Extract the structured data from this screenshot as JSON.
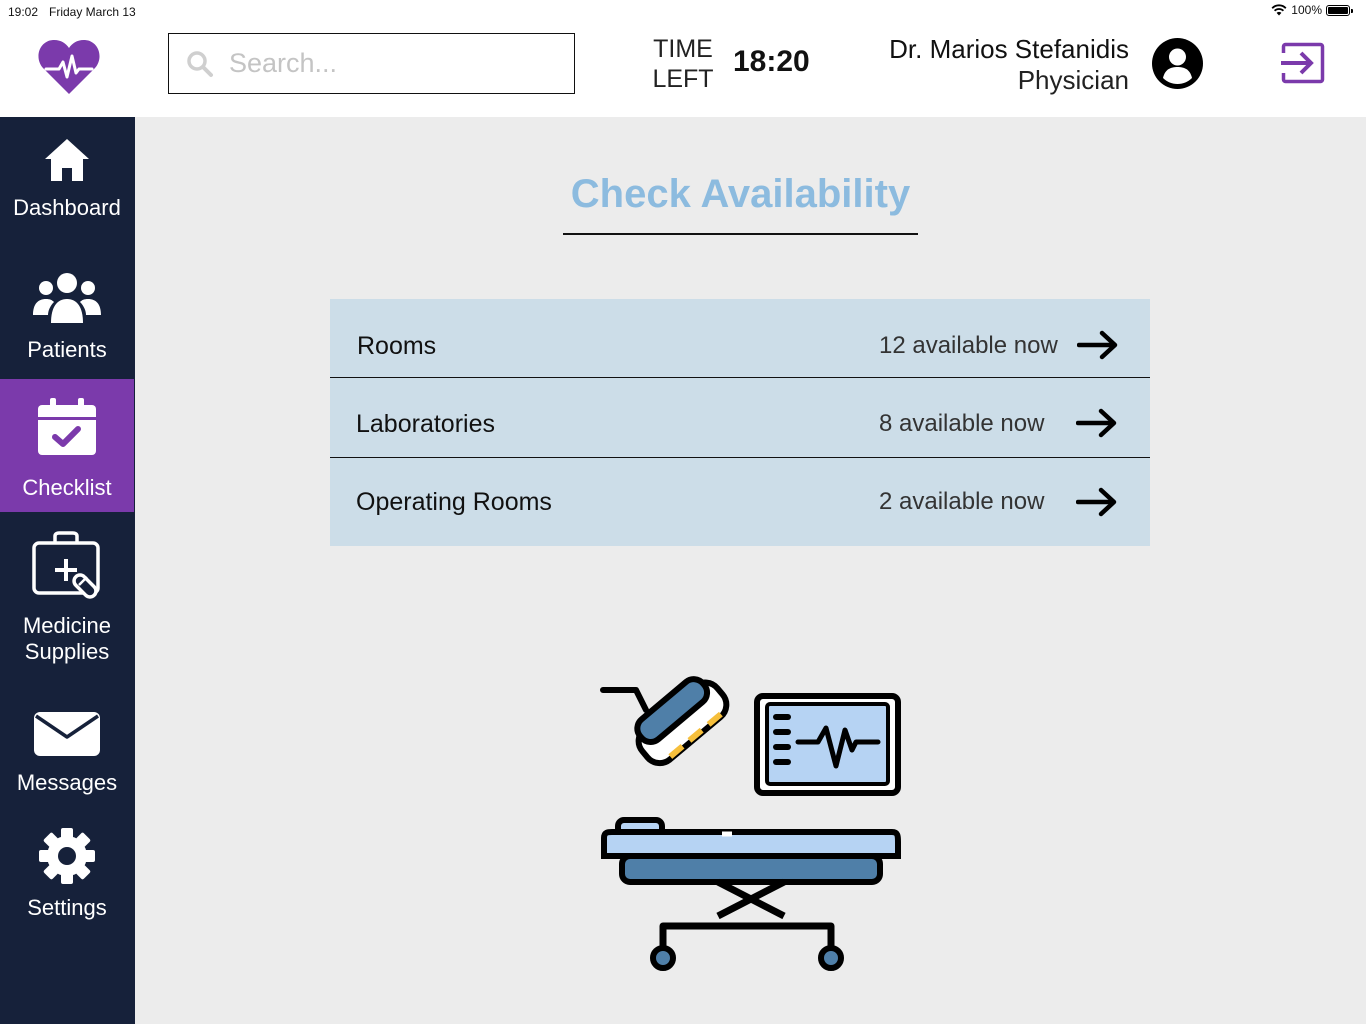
{
  "status_bar": {
    "time": "19:02",
    "date": "Friday March 13",
    "battery": "100%",
    "battery_level": 1.0
  },
  "header": {
    "app_logo_icon": "heart-pulse-icon",
    "search": {
      "placeholder": "Search...",
      "value": ""
    },
    "time_left_label_line1": "TIME",
    "time_left_label_line2": "LEFT",
    "time_left_value": "18:20",
    "user": {
      "name": "Dr. Marios Stefanidis",
      "role": "Physician",
      "avatar_icon": "user-circle-icon"
    },
    "logout_icon": "sign-out-icon"
  },
  "sidebar": {
    "items": [
      {
        "label": "Dashboard",
        "icon": "home-icon",
        "active": false
      },
      {
        "label": "Patients",
        "icon": "users-icon",
        "active": false
      },
      {
        "label": "Checklist",
        "icon": "calendar-check-icon",
        "active": true
      },
      {
        "label_line1": "Medicine",
        "label_line2": "Supplies",
        "icon": "medical-kit-icon",
        "active": false
      },
      {
        "label": "Messages",
        "icon": "envelope-icon",
        "active": false
      },
      {
        "label": "Settings",
        "icon": "gear-icon",
        "active": false
      }
    ]
  },
  "main": {
    "title": "Check Availability",
    "availability": [
      {
        "label": "Rooms",
        "status": "12 available now"
      },
      {
        "label": "Laboratories",
        "status": "8 available now"
      },
      {
        "label": "Operating Rooms",
        "status": "2 available now"
      }
    ]
  },
  "colors": {
    "sidebar_bg": "#16213a",
    "active_nav": "#7b3aab",
    "brand_purple": "#7b3aab",
    "title_blue": "#8cbbdf",
    "list_bg": "#ccdde8",
    "page_bg": "#ececec"
  }
}
